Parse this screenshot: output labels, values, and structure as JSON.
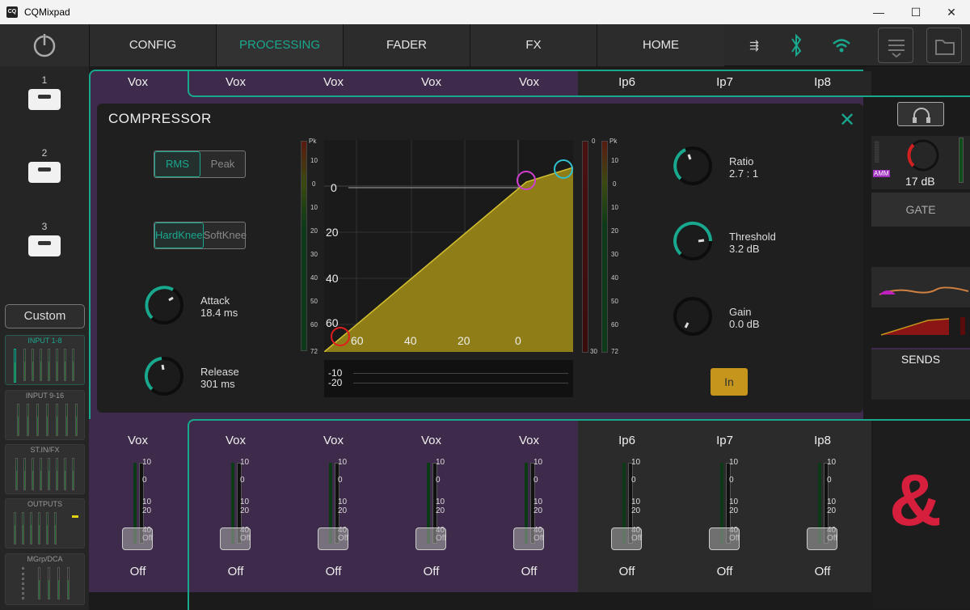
{
  "window": {
    "title": "CQMixpad",
    "logo_text": "CQ",
    "min": "—",
    "max": "☐",
    "close": "✕"
  },
  "nav": {
    "tabs": [
      {
        "label": "CONFIG"
      },
      {
        "label": "PROCESSING"
      },
      {
        "label": "FADER"
      },
      {
        "label": "FX"
      },
      {
        "label": "HOME"
      }
    ],
    "active": "PROCESSING"
  },
  "scenes": {
    "items": [
      "1",
      "2",
      "3"
    ],
    "custom_label": "Custom"
  },
  "banks": [
    {
      "label": "INPUT 1-8",
      "active": true
    },
    {
      "label": "INPUT 9-16"
    },
    {
      "label": "ST.IN/FX"
    },
    {
      "label": "OUTPUTS"
    },
    {
      "label": "MGrp/DCA"
    }
  ],
  "channel_tabs": [
    "Vox",
    "Vox",
    "Vox",
    "Vox",
    "Vox",
    "Ip6",
    "Ip7",
    "Ip8"
  ],
  "compressor": {
    "title": "COMPRESSOR",
    "detect": {
      "options": [
        "RMS",
        "Peak"
      ],
      "selected": "RMS"
    },
    "knee": {
      "options": [
        {
          "line1": "Hard",
          "line2": "Knee"
        },
        {
          "line1": "Soft",
          "line2": "Knee"
        }
      ],
      "selected": "Hard"
    },
    "attack": {
      "label": "Attack",
      "value": "18.4 ms"
    },
    "release": {
      "label": "Release",
      "value": "301 ms"
    },
    "ratio": {
      "label": "Ratio",
      "value": "2.7 : 1"
    },
    "threshold": {
      "label": "Threshold",
      "value": "3.2 dB"
    },
    "gain": {
      "label": "Gain",
      "value": "0.0 dB"
    },
    "in_button": "In",
    "graph_y_labels": [
      "0",
      "20",
      "40",
      "60"
    ],
    "graph_x_labels": [
      "60",
      "40",
      "20",
      "0"
    ],
    "gr_labels": [
      "-10",
      "-20"
    ],
    "meter_scale": [
      "Pk",
      "10",
      "0",
      "10",
      "20",
      "30",
      "40",
      "50",
      "60",
      "72"
    ],
    "out_meter_top": "0",
    "out_meter_bottom": "30"
  },
  "right_panel": {
    "comp_value": "17 dB",
    "gate_label": "GATE",
    "sends_label": "SENDS",
    "amm_label": "AMM"
  },
  "strips": [
    {
      "name": "Vox",
      "off": "Off"
    },
    {
      "name": "Vox",
      "off": "Off"
    },
    {
      "name": "Vox",
      "off": "Off"
    },
    {
      "name": "Vox",
      "off": "Off"
    },
    {
      "name": "Vox",
      "off": "Off"
    },
    {
      "name": "Ip6",
      "off": "Off"
    },
    {
      "name": "Ip7",
      "off": "Off"
    },
    {
      "name": "Ip8",
      "off": "Off"
    }
  ],
  "fader_scale": [
    "10",
    "0",
    "10",
    "20",
    "40",
    "Off"
  ],
  "brand_mark": "&",
  "colors": {
    "accent": "#19a88e",
    "purple": "#3e2a4a",
    "gold": "#c5951c",
    "brand": "#d61f3c"
  }
}
